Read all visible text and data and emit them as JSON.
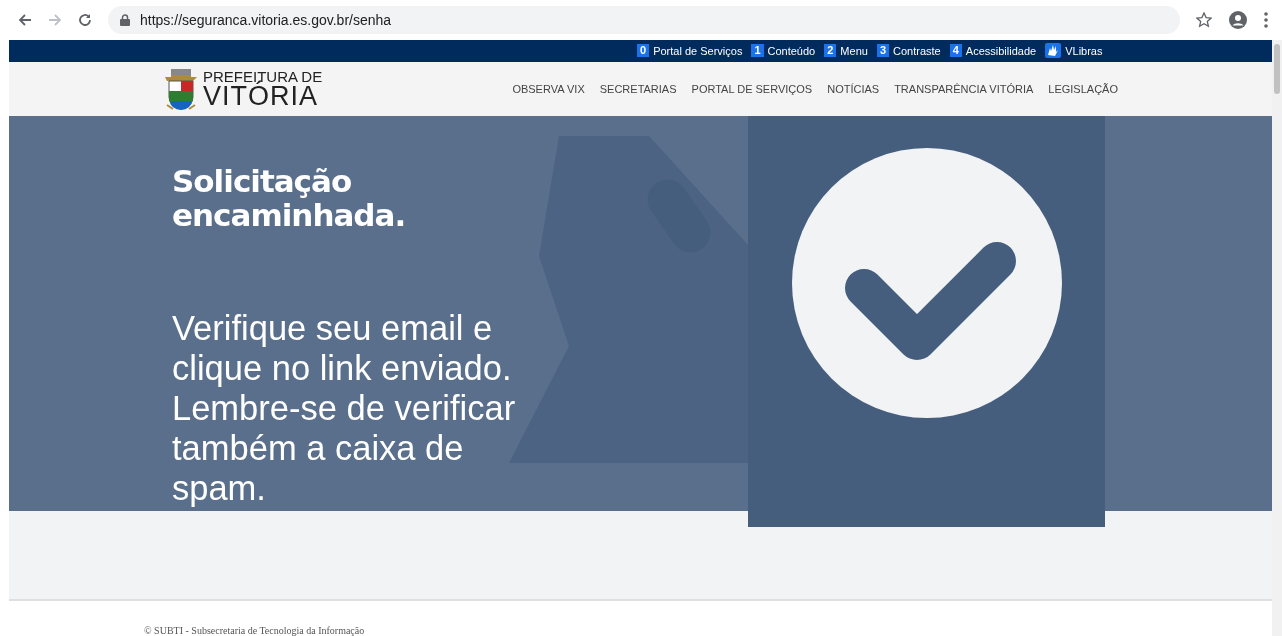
{
  "browser": {
    "url": "https://seguranca.vitoria.es.gov.br/senha"
  },
  "access_bar": {
    "links": [
      {
        "key": "0",
        "label": "Portal de Serviços"
      },
      {
        "key": "1",
        "label": "Conteúdo"
      },
      {
        "key": "2",
        "label": "Menu"
      },
      {
        "key": "3",
        "label": "Contraste"
      },
      {
        "key": "4",
        "label": "Acessibilidade"
      }
    ],
    "vlibras": "VLibras"
  },
  "header": {
    "logo_line_1": "PREFEITURA DE",
    "logo_line_2": "VITÓRIA",
    "nav": [
      "OBSERVA VIX",
      "SECRETARIAS",
      "PORTAL DE SERVIÇOS",
      "NOTÍCIAS",
      "TRANSPARÊNCIA VITÓRIA",
      "LEGISLAÇÃO"
    ]
  },
  "hero": {
    "title": "Solicitação encaminhada.",
    "message": "Verifique seu email e clique no link enviado. Lembre-se de verificar também a caixa de spam."
  },
  "footer": {
    "text": "© SUBTI - Subsecretaria de Tecnologia da Informação"
  }
}
